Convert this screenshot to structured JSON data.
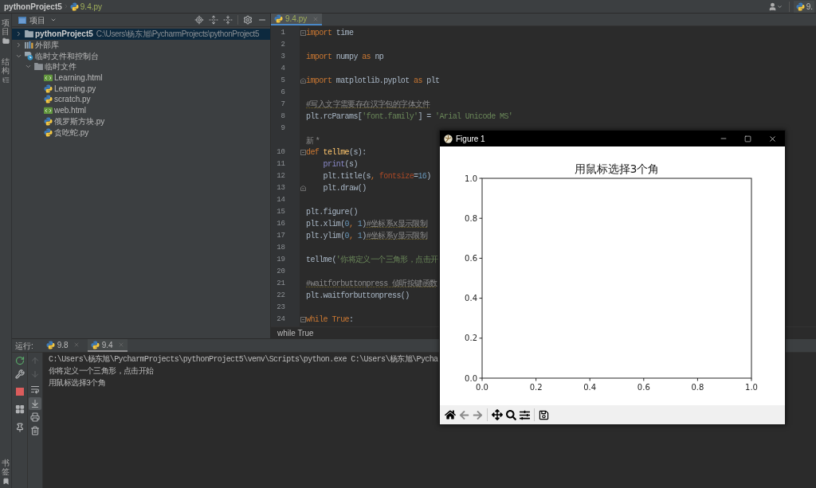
{
  "top_bar": {
    "breadcrumb": [
      {
        "kind": "project",
        "label": "pythonProject5"
      },
      {
        "kind": "file",
        "label": "9.4.py"
      }
    ],
    "run_config": "9."
  },
  "tool_strip": {
    "top": [
      {
        "kind": "project",
        "label": "项目"
      },
      {
        "kind": "structure",
        "label": "结构"
      }
    ],
    "bottom": [
      {
        "kind": "bookmarks",
        "label": "书签"
      }
    ]
  },
  "project_panel": {
    "title": "项目",
    "tree": [
      {
        "kind": "project",
        "label": "pythonProject5",
        "path": "C:\\Users\\杨东旭\\PycharmProjects\\pythonProject5",
        "expanded": false,
        "selected": true
      },
      {
        "kind": "library",
        "label": "外部库",
        "expanded": false,
        "selected": false
      },
      {
        "kind": "scratches",
        "label": "临时文件和控制台",
        "expanded": true,
        "selected": false,
        "children": [
          {
            "kind": "folder",
            "label": "临时文件",
            "expanded": true,
            "selected": false,
            "children": [
              {
                "kind": "html",
                "label": "Learning.html",
                "selected": false
              },
              {
                "kind": "py",
                "label": "Learning.py",
                "selected": false
              },
              {
                "kind": "py",
                "label": "scratch.py",
                "selected": false
              },
              {
                "kind": "html",
                "label": "web.html",
                "selected": false
              },
              {
                "kind": "py",
                "label": "俄罗斯方块.py",
                "selected": false
              },
              {
                "kind": "py",
                "label": "贪吃蛇.py",
                "selected": false
              }
            ]
          }
        ]
      }
    ]
  },
  "editor": {
    "tabs": [
      {
        "label": "9.4.py",
        "selected": true
      }
    ],
    "lines": [
      {
        "kind": "code",
        "number": "1",
        "fold_start": true,
        "tokens": [
          {
            "kind": "keyword",
            "text": "import"
          },
          {
            "kind": "plain",
            "text": " time"
          }
        ]
      },
      {
        "kind": "code",
        "number": "2"
      },
      {
        "kind": "code",
        "number": "3",
        "tokens": [
          {
            "kind": "keyword",
            "text": "import"
          },
          {
            "kind": "plain",
            "text": " numpy "
          },
          {
            "kind": "keyword",
            "text": "as"
          },
          {
            "kind": "plain",
            "text": " np"
          }
        ]
      },
      {
        "kind": "code",
        "number": "4"
      },
      {
        "kind": "code",
        "number": "5",
        "fold_end": true,
        "tokens": [
          {
            "kind": "keyword",
            "text": "import"
          },
          {
            "kind": "plain",
            "text": " matplotlib.pyplot "
          },
          {
            "kind": "keyword",
            "text": "as"
          },
          {
            "kind": "plain",
            "text": " plt"
          }
        ]
      },
      {
        "kind": "code",
        "number": "6"
      },
      {
        "kind": "code",
        "number": "7",
        "tokens": [
          {
            "kind": "comment",
            "text": "#写入文字需要存在汉字包的字体文件"
          }
        ]
      },
      {
        "kind": "code",
        "number": "8",
        "tokens": [
          {
            "kind": "plain",
            "text": "plt.rcParams["
          },
          {
            "kind": "string",
            "text": "'font.family'"
          },
          {
            "kind": "plain",
            "text": "] = "
          },
          {
            "kind": "string",
            "text": "'Arial Unicode MS'"
          }
        ]
      },
      {
        "kind": "code",
        "number": "9"
      },
      {
        "kind": "hint",
        "text": "新 *"
      },
      {
        "kind": "code",
        "number": "10",
        "fold_start": true,
        "tokens": [
          {
            "kind": "keyword",
            "text": "def "
          },
          {
            "kind": "funcdef",
            "text": "tellme"
          },
          {
            "kind": "plain",
            "text": "(s):"
          }
        ]
      },
      {
        "kind": "code",
        "number": "11",
        "tokens": [
          {
            "kind": "builtin",
            "text": "    print"
          },
          {
            "kind": "plain",
            "text": "(s)"
          }
        ]
      },
      {
        "kind": "code",
        "number": "12",
        "tokens": [
          {
            "kind": "plain",
            "text": "    plt.title(s"
          },
          {
            "kind": "punct",
            "text": ", "
          },
          {
            "kind": "param",
            "text": "fontsize"
          },
          {
            "kind": "plain",
            "text": "="
          },
          {
            "kind": "number",
            "text": "16"
          },
          {
            "kind": "plain",
            "text": ")"
          }
        ]
      },
      {
        "kind": "code",
        "number": "13",
        "fold_end": true,
        "tokens": [
          {
            "kind": "plain",
            "text": "    plt.draw()"
          }
        ]
      },
      {
        "kind": "code",
        "number": "14"
      },
      {
        "kind": "code",
        "number": "15",
        "tokens": [
          {
            "kind": "plain",
            "text": "plt.figure()"
          }
        ]
      },
      {
        "kind": "code",
        "number": "16",
        "tokens": [
          {
            "kind": "plain",
            "text": "plt.xlim("
          },
          {
            "kind": "number",
            "text": "0"
          },
          {
            "kind": "punct",
            "text": ", "
          },
          {
            "kind": "number",
            "text": "1"
          },
          {
            "kind": "plain",
            "text": ")"
          },
          {
            "kind": "comment",
            "text": "#坐标系x显示限制"
          }
        ]
      },
      {
        "kind": "code",
        "number": "17",
        "tokens": [
          {
            "kind": "plain",
            "text": "plt.ylim("
          },
          {
            "kind": "number",
            "text": "0"
          },
          {
            "kind": "punct",
            "text": ", "
          },
          {
            "kind": "number",
            "text": "1"
          },
          {
            "kind": "plain",
            "text": ")"
          },
          {
            "kind": "comment",
            "text": "#坐标系y显示限制"
          }
        ]
      },
      {
        "kind": "code",
        "number": "18"
      },
      {
        "kind": "code",
        "number": "19",
        "tokens": [
          {
            "kind": "plain",
            "text": "tellme("
          },
          {
            "kind": "string",
            "text": "'你将定义一个三角形，点击开"
          }
        ]
      },
      {
        "kind": "code",
        "number": "20"
      },
      {
        "kind": "code",
        "number": "21",
        "tokens": [
          {
            "kind": "comment",
            "text": "#waitforbuttonpress 侦听按键函数"
          }
        ]
      },
      {
        "kind": "code",
        "number": "22",
        "tokens": [
          {
            "kind": "plain",
            "text": "plt.waitforbuttonpress()"
          }
        ]
      },
      {
        "kind": "code",
        "number": "23"
      },
      {
        "kind": "code",
        "number": "24",
        "fold_start": true,
        "tokens": [
          {
            "kind": "keyword",
            "text": "while True"
          },
          {
            "kind": "plain",
            "text": ":"
          }
        ]
      }
    ],
    "breadcrumb": "while True"
  },
  "figure_window": {
    "title": "Figure 1",
    "chart_data": {
      "type": "line",
      "title": "用鼠标选择3个角",
      "xlim": [
        0,
        1
      ],
      "ylim": [
        0,
        1
      ],
      "xticks": [
        {
          "value": 0,
          "label": "0.0"
        },
        {
          "value": 0.2,
          "label": "0.2"
        },
        {
          "value": 0.4,
          "label": "0.4"
        },
        {
          "value": 0.6,
          "label": "0.6"
        },
        {
          "value": 0.8,
          "label": "0.8"
        },
        {
          "value": 1,
          "label": "1.0"
        }
      ],
      "yticks": [
        {
          "value": 0,
          "label": "0.0"
        },
        {
          "value": 0.2,
          "label": "0.2"
        },
        {
          "value": 0.4,
          "label": "0.4"
        },
        {
          "value": 0.6,
          "label": "0.6"
        },
        {
          "value": 0.8,
          "label": "0.8"
        },
        {
          "value": 1,
          "label": "1.0"
        }
      ]
    },
    "toolbar": {
      "back": {
        "disabled": true
      },
      "forward": {
        "disabled": true
      }
    }
  },
  "run_panel": {
    "label": "运行:",
    "tabs": [
      {
        "label": "9.8",
        "selected": false
      },
      {
        "label": "9.4",
        "selected": true
      }
    ],
    "toolbar": {
      "up": {
        "disabled": true
      },
      "down": {
        "disabled": true
      },
      "scroll_to_end": {
        "on": true
      }
    },
    "output": [
      "C:\\Users\\杨东旭\\PycharmProjects\\pythonProject5\\venv\\Scripts\\python.exe C:\\Users\\杨东旭\\Pycha",
      "你将定义一个三角形，点击开始",
      "用鼠标选择3个角"
    ]
  }
}
